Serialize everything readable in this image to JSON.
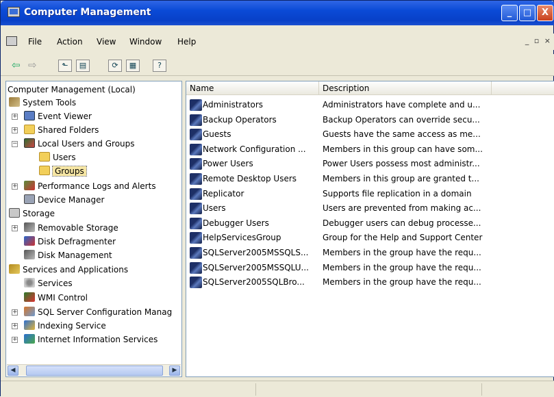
{
  "window": {
    "title": "Computer Management",
    "min": "_",
    "max": "□",
    "close": "X"
  },
  "menu": [
    "File",
    "Action",
    "View",
    "Window",
    "Help"
  ],
  "toolbar": {
    "back": "⇦",
    "forward": "⇨"
  },
  "tree": {
    "root": "Computer Management (Local)",
    "system_tools": "System Tools",
    "event_viewer": "Event Viewer",
    "shared_folders": "Shared Folders",
    "local_users_groups": "Local Users and Groups",
    "users": "Users",
    "groups": "Groups",
    "perf_logs": "Performance Logs and Alerts",
    "device_manager": "Device Manager",
    "storage": "Storage",
    "removable_storage": "Removable Storage",
    "disk_defrag": "Disk Defragmenter",
    "disk_mgmt": "Disk Management",
    "services_apps": "Services and Applications",
    "services": "Services",
    "wmi": "WMI Control",
    "sql_config": "SQL Server Configuration Manag",
    "indexing": "Indexing Service",
    "iis": "Internet Information Services"
  },
  "list": {
    "columns": [
      "Name",
      "Description"
    ],
    "rows": [
      {
        "name": "Administrators",
        "desc": "Administrators have complete and u..."
      },
      {
        "name": "Backup Operators",
        "desc": "Backup Operators can override secu..."
      },
      {
        "name": "Guests",
        "desc": "Guests have the same access as me..."
      },
      {
        "name": "Network Configuration ...",
        "desc": "Members in this group can have som..."
      },
      {
        "name": "Power Users",
        "desc": "Power Users possess most administr..."
      },
      {
        "name": "Remote Desktop Users",
        "desc": "Members in this group are granted t..."
      },
      {
        "name": "Replicator",
        "desc": "Supports file replication in a domain"
      },
      {
        "name": "Users",
        "desc": "Users are prevented from making ac..."
      },
      {
        "name": "Debugger Users",
        "desc": "Debugger users can debug processe..."
      },
      {
        "name": "HelpServicesGroup",
        "desc": "Group for the Help and Support Center"
      },
      {
        "name": "SQLServer2005MSSQLS...",
        "desc": "Members in the group have the requ..."
      },
      {
        "name": "SQLServer2005MSSQLU...",
        "desc": "Members in the group have the requ..."
      },
      {
        "name": "SQLServer2005SQLBro...",
        "desc": "Members in the group have the requ..."
      }
    ]
  }
}
